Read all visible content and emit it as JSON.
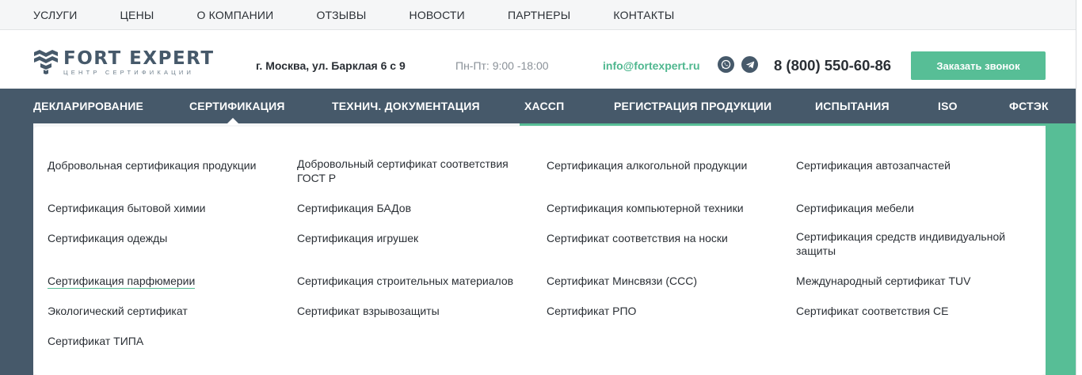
{
  "topnav": [
    "УСЛУГИ",
    "ЦЕНЫ",
    "О КОМПАНИИ",
    "ОТЗЫВЫ",
    "НОВОСТИ",
    "ПАРТНЕРЫ",
    "КОНТАКТЫ"
  ],
  "header": {
    "logo_title": "FORT EXPERT",
    "logo_subtitle": "ЦЕНТР СЕРТИФИКАЦИИ",
    "address": "г. Москва, ул. Барклая 6 с 9",
    "hours": "Пн-Пт: 9:00 -18:00",
    "email": "info@fortexpert.ru",
    "phone": "8 (800) 550-60-86",
    "callback_label": "Заказать звонок",
    "social_icons": [
      "whatsapp-icon",
      "telegram-icon"
    ]
  },
  "mainnav": [
    "ДЕКЛАРИРОВАНИЕ",
    "СЕРТИФИКАЦИЯ",
    "ТЕХНИЧ. ДОКУМЕНТАЦИЯ",
    "ХАССП",
    "РЕГИСТРАЦИЯ ПРОДУКЦИИ",
    "ИСПЫТАНИЯ",
    "ISO",
    "ФСТЭК"
  ],
  "mainnav_active": "СЕРТИФИКАЦИЯ",
  "dropdown": {
    "col1": [
      "Добровольная сертификация продукции",
      "Сертификация бытовой химии",
      "Сертификация одежды",
      "Сертификация парфюмерии",
      "Экологический сертификат",
      "Сертификат ТИПА"
    ],
    "col2": [
      "Добровольный сертификат соответствия ГОСТ Р",
      "Сертификация БАДов",
      "Сертификация игрушек",
      "Сертификация строительных материалов",
      "Сертификат взрывозащиты"
    ],
    "col3": [
      "Сертификация алкогольной продукции",
      "Сертификация компьютерной техники",
      "Сертификат соответствия на носки",
      "Сертификат Минсвязи (ССС)",
      "Сертификат РПО"
    ],
    "col4": [
      "Сертификация автозапчастей",
      "Сертификация мебели",
      "Сертификация средств индивидуальной защиты",
      "Международный сертификат TUV",
      "Сертификат соответствия CE"
    ],
    "active_item": "Сертификация парфюмерии"
  },
  "colors": {
    "nav_bg": "#46596a",
    "accent": "#57be96",
    "text": "#2a2f35"
  }
}
